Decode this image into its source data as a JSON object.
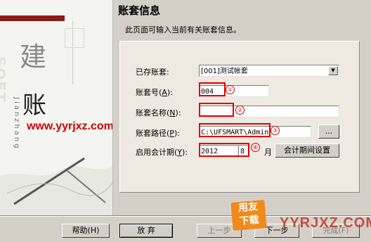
{
  "header": {
    "title": "账套信息",
    "subtitle": "此页面可输入当前有关账套信息。"
  },
  "side": {
    "char1": "建",
    "char2": "账",
    "pinyin": "Jianzhang",
    "soft_text": "SOFT",
    "watermark": "www.yyrjxz.com"
  },
  "form": {
    "existing_label_pre": "已存账套:",
    "existing_value": "[001]测试帐套",
    "code_label_pre": "账套号(",
    "code_label_key": "A",
    "code_label_post": "):",
    "code_value": "004",
    "name_label_pre": "账套名称(",
    "name_label_key": "N",
    "name_label_post": "):",
    "name_value": "",
    "path_label_pre": "账套路径(",
    "path_label_key": "P",
    "path_label_post": "):",
    "path_value": "C:\\UFSMART\\Admin",
    "browse_label": "...",
    "period_label_pre": "启用会计期(",
    "period_label_key": "Y",
    "period_label_post": "):",
    "year_value": "2012",
    "month_value": "8",
    "month_unit": "月",
    "period_settings_label": "会计期间设置"
  },
  "annotations": [
    "①",
    "②",
    "③",
    "④"
  ],
  "footer": {
    "help_label": "帮助(H)",
    "cancel_label": "放 弃",
    "prev_label": "上一步",
    "next_label": "下一步",
    "finish_label": "完成(F)"
  },
  "logo": {
    "line1": "用友",
    "line2": "下载",
    "site": "YYRJXZ.COM"
  },
  "colors": {
    "annotation_red": "#e00000",
    "accent_bar": "#8b1a1a",
    "logo_orange": "#f08a1c"
  }
}
